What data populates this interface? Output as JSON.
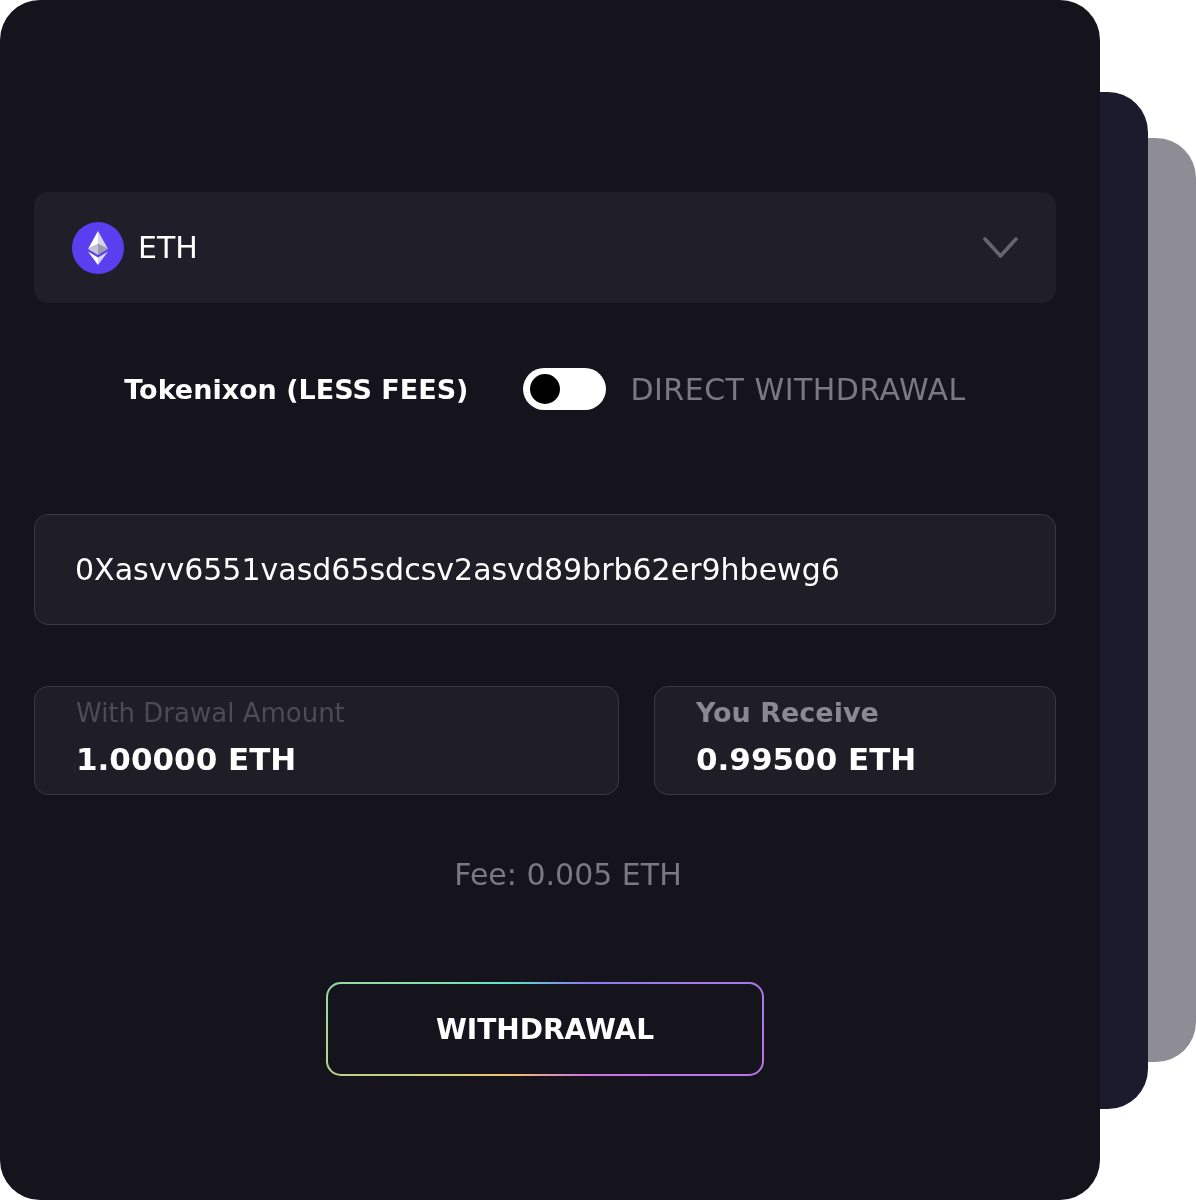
{
  "asset_select": {
    "symbol": "ETH"
  },
  "method": {
    "options": [
      {
        "label": "Tokenixon (LESS FEES)",
        "selected": true
      },
      {
        "label": "DIRECT WITHDRAWAL",
        "selected": false
      }
    ]
  },
  "address": {
    "value": "0Xasvv6551vasd65sdcsv2asvd89brb62er9hbewg6"
  },
  "amounts": [
    {
      "kind": "input",
      "label": "With Drawal Amount",
      "value": "1.00000 ETH"
    },
    {
      "kind": "readout",
      "label": "You Receive",
      "value": "0.99500 ETH"
    }
  ],
  "fee": "Fee: 0.005 ETH",
  "button": {
    "label": "WITHDRAWAL"
  }
}
